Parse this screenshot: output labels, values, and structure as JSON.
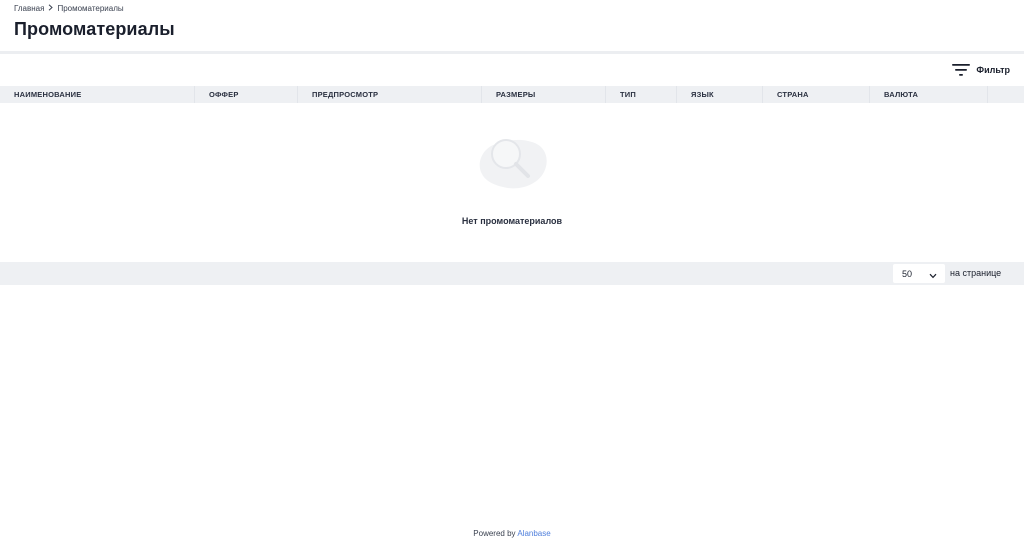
{
  "breadcrumb": {
    "home": "Главная",
    "current": "Промоматериалы"
  },
  "page": {
    "title": "Промоматериалы"
  },
  "toolbar": {
    "filter_label": "Фильтр",
    "filter_icon": "filter-lines-icon"
  },
  "table": {
    "columns": [
      "НАИМЕНОВАНИЕ",
      "ОФФЕР",
      "ПРЕДПРОСМОТР",
      "РАЗМЕРЫ",
      "ТИП",
      "ЯЗЫК",
      "СТРАНА",
      "ВАЛЮТА"
    ],
    "empty_message": "Нет промоматериалов",
    "empty_icon": "magnifier-empty-icon"
  },
  "pagination": {
    "per_page_value": "50",
    "per_page_label": "на странице"
  },
  "footer": {
    "powered_by": "Powered by",
    "brand": "Alanbase"
  },
  "colors": {
    "accent": "#4f7fdc",
    "header_bg": "#eef0f3",
    "text": "#1a1f2c"
  }
}
